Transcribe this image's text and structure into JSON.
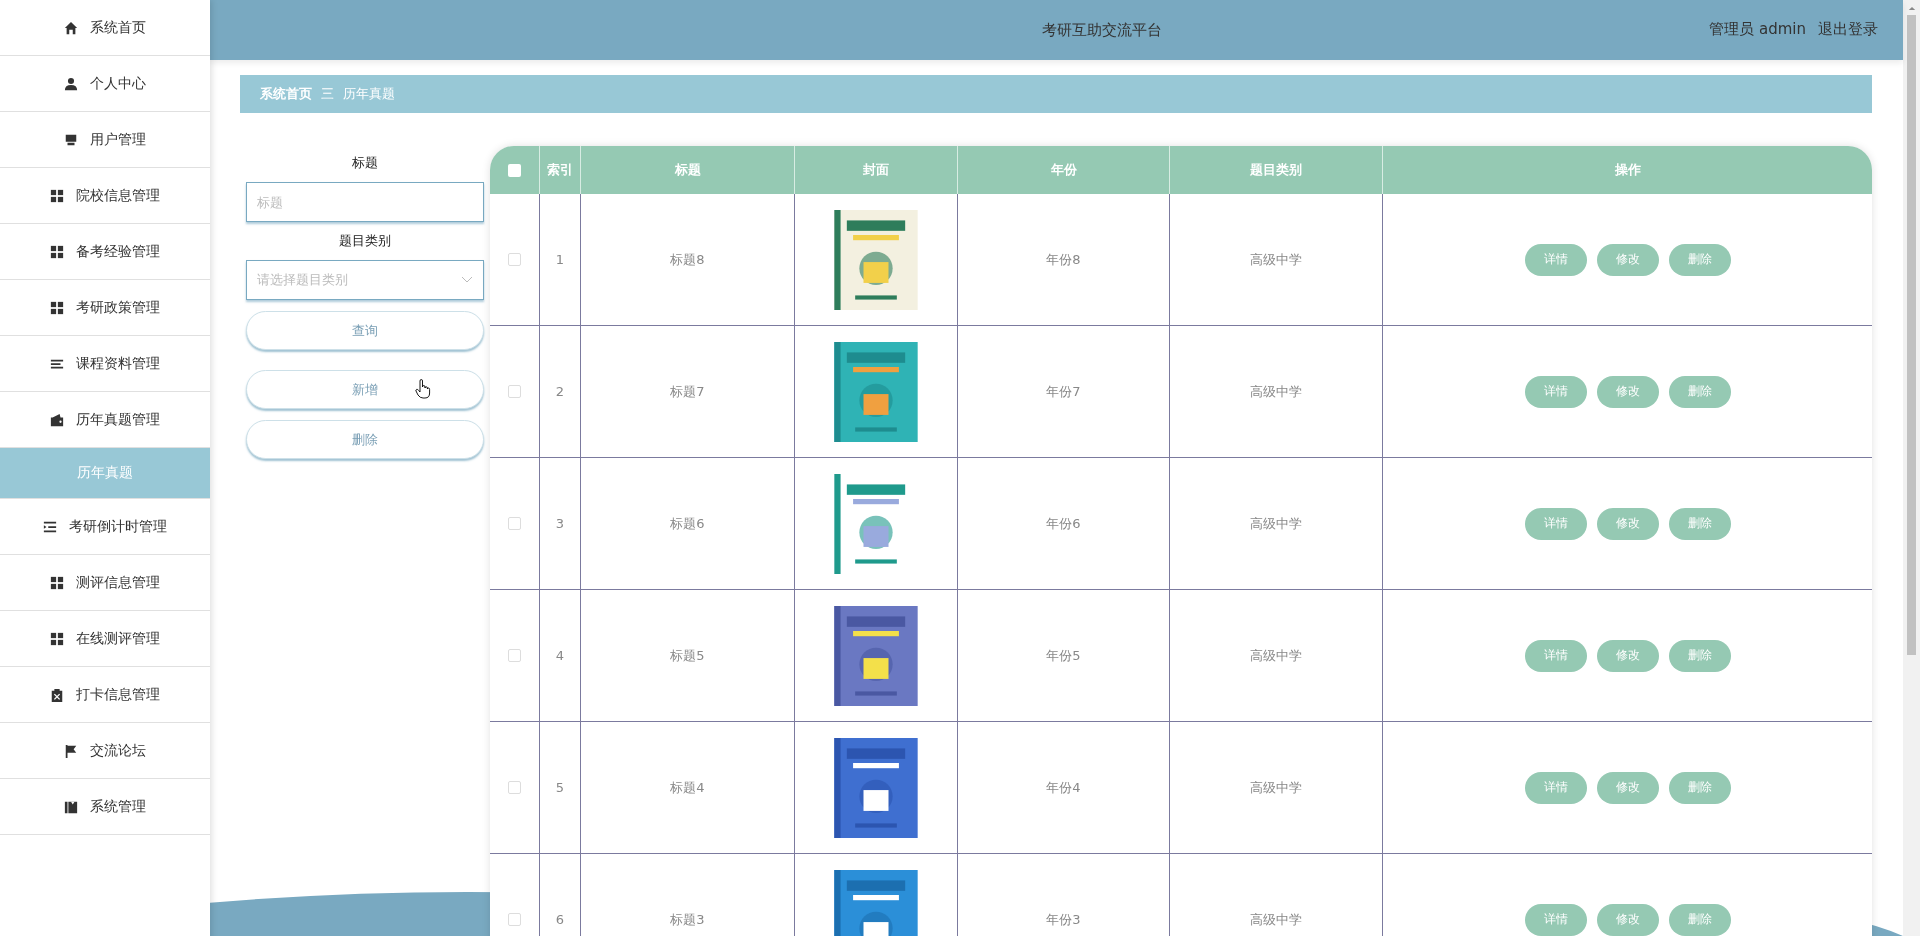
{
  "sidebar": {
    "items": [
      {
        "label": "系统首页",
        "selected": false
      },
      {
        "label": "个人中心",
        "selected": false
      },
      {
        "label": "用户管理",
        "selected": false
      },
      {
        "label": "院校信息管理",
        "selected": false
      },
      {
        "label": "备考经验管理",
        "selected": false
      },
      {
        "label": "考研政策管理",
        "selected": false
      },
      {
        "label": "课程资料管理",
        "selected": false
      },
      {
        "label": "历年真题管理",
        "selected": false
      },
      {
        "label": "历年真题",
        "selected": true
      },
      {
        "label": "考研倒计时管理",
        "selected": false
      },
      {
        "label": "测评信息管理",
        "selected": false
      },
      {
        "label": "在线测评管理",
        "selected": false
      },
      {
        "label": "打卡信息管理",
        "selected": false
      },
      {
        "label": "交流论坛",
        "selected": false
      },
      {
        "label": "系统管理",
        "selected": false
      }
    ]
  },
  "header": {
    "title": "考研互助交流平台",
    "user": "管理员 admin",
    "logout": "退出登录"
  },
  "breadcrumb": {
    "home": "系统首页",
    "separator": "三",
    "current": "历年真题"
  },
  "search": {
    "title_label": "标题",
    "title_placeholder": "标题",
    "category_label": "题目类别",
    "category_placeholder": "请选择题目类别",
    "buttons": [
      "查询",
      "新增",
      "删除"
    ]
  },
  "table": {
    "select_all_checked": false,
    "columns": [
      "索引",
      "标题",
      "封面",
      "年份",
      "题目类别",
      "操作"
    ],
    "rows": [
      {
        "checked": false,
        "index": "1",
        "title": "标题8",
        "year": "年份8",
        "category": "高级中学",
        "actions": [
          "详情",
          "修改",
          "删除"
        ]
      },
      {
        "checked": false,
        "index": "2",
        "title": "标题7",
        "year": "年份7",
        "category": "高级中学",
        "actions": [
          "详情",
          "修改",
          "删除"
        ]
      },
      {
        "checked": false,
        "index": "3",
        "title": "标题6",
        "year": "年份6",
        "category": "高级中学",
        "actions": [
          "详情",
          "修改",
          "删除"
        ]
      },
      {
        "checked": false,
        "index": "4",
        "title": "标题5",
        "year": "年份5",
        "category": "高级中学",
        "actions": [
          "详情",
          "修改",
          "删除"
        ]
      },
      {
        "checked": false,
        "index": "5",
        "title": "标题4",
        "year": "年份4",
        "category": "高级中学",
        "actions": [
          "详情",
          "修改",
          "删除"
        ]
      },
      {
        "checked": false,
        "index": "6",
        "title": "标题3",
        "year": "年份3",
        "category": "高级中学",
        "actions": [
          "详情",
          "修改",
          "删除"
        ]
      }
    ]
  }
}
